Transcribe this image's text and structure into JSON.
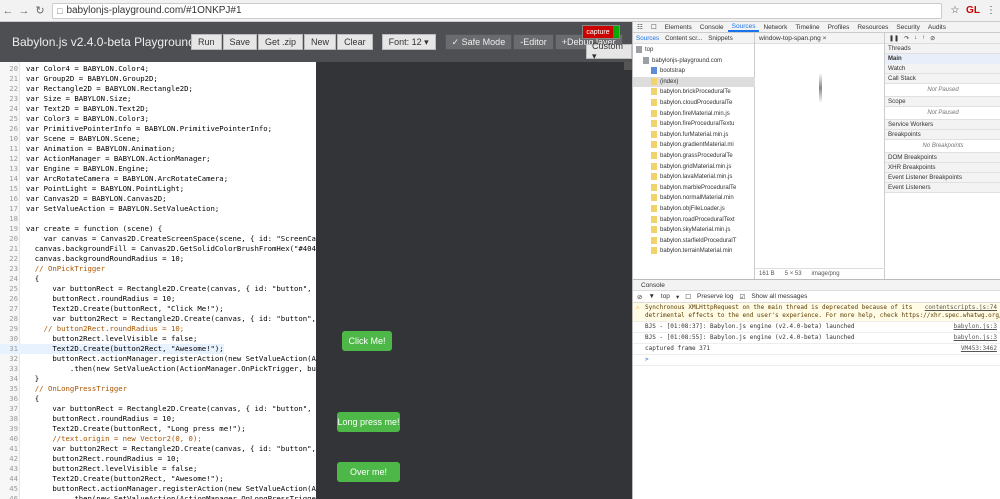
{
  "browser": {
    "url": "babylonjs-playground.com/#1ONKPJ#1",
    "ext_label": "GL"
  },
  "toolbar": {
    "title": "Babylon.js v2.4.0-beta Playground",
    "run": "Run",
    "save": "Save",
    "get_zip": "Get .zip",
    "new": "New",
    "clear": "Clear",
    "font": "Font: 12 ▾",
    "safe_mode": "✓ Safe Mode",
    "editor": "-Editor",
    "debug_layer": "+Debug layer",
    "custom": "Custom ▾",
    "capture": "capture"
  },
  "code": [
    [
      "20",
      "var Color4 = BABYLON.Color4;"
    ],
    [
      "21",
      "var Group2D = BABYLON.Group2D;"
    ],
    [
      "22",
      "var Rectangle2D = BABYLON.Rectangle2D;"
    ],
    [
      "23",
      "var Size = BABYLON.Size;"
    ],
    [
      "24",
      "var Text2D = BABYLON.Text2D;"
    ],
    [
      "25",
      "var Color3 = BABYLON.Color3;"
    ],
    [
      "26",
      "var PrimitivePointerInfo = BABYLON.PrimitivePointerInfo;"
    ],
    [
      "10",
      "var Scene = BABYLON.Scene;"
    ],
    [
      "11",
      "var Animation = BABYLON.Animation;"
    ],
    [
      "12",
      "var ActionManager = BABYLON.ActionManager;"
    ],
    [
      "13",
      "var Engine = BABYLON.Engine;"
    ],
    [
      "14",
      "var ArcRotateCamera = BABYLON.ArcRotateCamera;"
    ],
    [
      "15",
      "var PointLight = BABYLON.PointLight;"
    ],
    [
      "16",
      "var Canvas2D = BABYLON.Canvas2D;"
    ],
    [
      "17",
      "var SetValueAction = BABYLON.SetValueAction;"
    ],
    [
      "18",
      ""
    ],
    [
      "19",
      "var create = function (scene) {"
    ],
    [
      "20",
      "    var canvas = Canvas2D.CreateScreenSpace(scene, { id: \"ScreenCanvas\""
    ],
    [
      "21",
      "  canvas.backgroundFill = Canvas2D.GetSolidColorBrushFromHex(\"#404040"
    ],
    [
      "22",
      "  canvas.backgroundRoundRadius = 10;"
    ],
    [
      "23",
      "  // OnPickTrigger"
    ],
    [
      "24",
      "  {"
    ],
    [
      "25",
      "      var buttonRect = Rectangle2D.Create(canvas, { id: \"button\", x: 1"
    ],
    [
      "26",
      "      buttonRect.roundRadius = 10;"
    ],
    [
      "27",
      "      Text2D.Create(buttonRect, \"Click Me!\");"
    ],
    [
      "28",
      "      var button2Rect = Rectangle2D.Create(canvas, { id: \"button\", x:"
    ],
    [
      "29",
      "    // button2Rect.roundRadius = 10;"
    ],
    [
      "30",
      "      button2Rect.levelVisible = false;"
    ],
    [
      "31",
      "      Text2D.Create(button2Rect, \"Awesome!\");"
    ],
    [
      "32",
      "      buttonRect.actionManager.registerAction(new SetValueAction(Actio"
    ],
    [
      "33",
      "          .then(new SetValueAction(ActionManager.OnPickTrigger, button2"
    ],
    [
      "34",
      "  }"
    ],
    [
      "35",
      "  // OnLongPressTrigger"
    ],
    [
      "36",
      "  {"
    ],
    [
      "37",
      "      var buttonRect = Rectangle2D.Create(canvas, { id: \"button\", x: 1"
    ],
    [
      "38",
      "      buttonRect.roundRadius = 10;"
    ],
    [
      "39",
      "      Text2D.Create(buttonRect, \"Long press me!\");"
    ],
    [
      "40",
      "      //text.origin = new Vector2(0, 0);"
    ],
    [
      "41",
      "      var button2Rect = Rectangle2D.Create(canvas, { id: \"button\", x:"
    ],
    [
      "42",
      "      button2Rect.roundRadius = 10;"
    ],
    [
      "43",
      "      button2Rect.levelVisible = false;"
    ],
    [
      "44",
      "      Text2D.Create(button2Rect, \"Awesome!\");"
    ],
    [
      "45",
      "      buttonRect.actionManager.registerAction(new SetValueAction(Actio"
    ],
    [
      "46",
      "          .then(new SetValueAction(ActionManager.OnLongPressTrigger, b"
    ]
  ],
  "canvas_buttons": {
    "click": "Click Me!",
    "long": "Long press me!",
    "over": "Over me!"
  },
  "devtools": {
    "tabs": [
      "Elements",
      "Console",
      "Sources",
      "Network",
      "Timeline",
      "Profiles",
      "Resources",
      "Security",
      "Audits"
    ],
    "active_tab": "Sources",
    "src_tabs": [
      "Sources",
      "Content scr...",
      "Snippets"
    ],
    "tree": [
      "top",
      "babylonjs-playground.com",
      "bootstrap",
      "(index)",
      "babylon.brickProceduralTe",
      "babylon.cloudProceduralTe",
      "babylon.fireMaterial.min.js",
      "babylon.fireProceduralTextu",
      "babylon.furMaterial.min.js",
      "babylon.gradientMaterial.mi",
      "babylon.grassProceduralTe",
      "babylon.gridMaterial.min.js",
      "babylon.lavaMaterial.min.js",
      "babylon.marbleProceduralTe",
      "babylon.normalMaterial.min",
      "babylon.objFileLoader.js",
      "babylon.roadProceduralText",
      "babylon.skyMaterial.min.js",
      "babylon.starfieldProceduralT",
      "babylon.terrainMaterial.min"
    ],
    "file_tab": "window-top-span.png ×",
    "file_status": [
      "161 B",
      "5 × 53",
      "image/png"
    ],
    "sections": [
      "Threads",
      "Main",
      "Watch",
      "Call Stack",
      "Not Paused",
      "Scope",
      "Not Paused",
      "Service Workers",
      "Breakpoints",
      "No Breakpoints",
      "DOM Breakpoints",
      "XHR Breakpoints",
      "Event Listener Breakpoints",
      "Event Listeners"
    ],
    "console_tab": "Console",
    "filter": "top",
    "preserve_log": "Preserve log",
    "show_all": "Show all messages",
    "messages": [
      {
        "text": "Synchronous XMLHttpRequest on the main thread is deprecated because of its\ndetrimental effects to the end user's experience. For more help, check https://xhr.spec.whatwg.org/.",
        "src": "contentscripts.js:74",
        "warn": true
      },
      {
        "text": "BJS - [01:08:37]: Babylon.js engine (v2.4.0-beta) launched",
        "src": "babylon.js:3",
        "warn": false
      },
      {
        "text": "BJS - [01:08:55]: Babylon.js engine (v2.4.0-beta) launched",
        "src": "babylon.js:3",
        "warn": false
      },
      {
        "text": "captured frame 371",
        "src": "VM453:3462",
        "warn": false
      }
    ]
  }
}
